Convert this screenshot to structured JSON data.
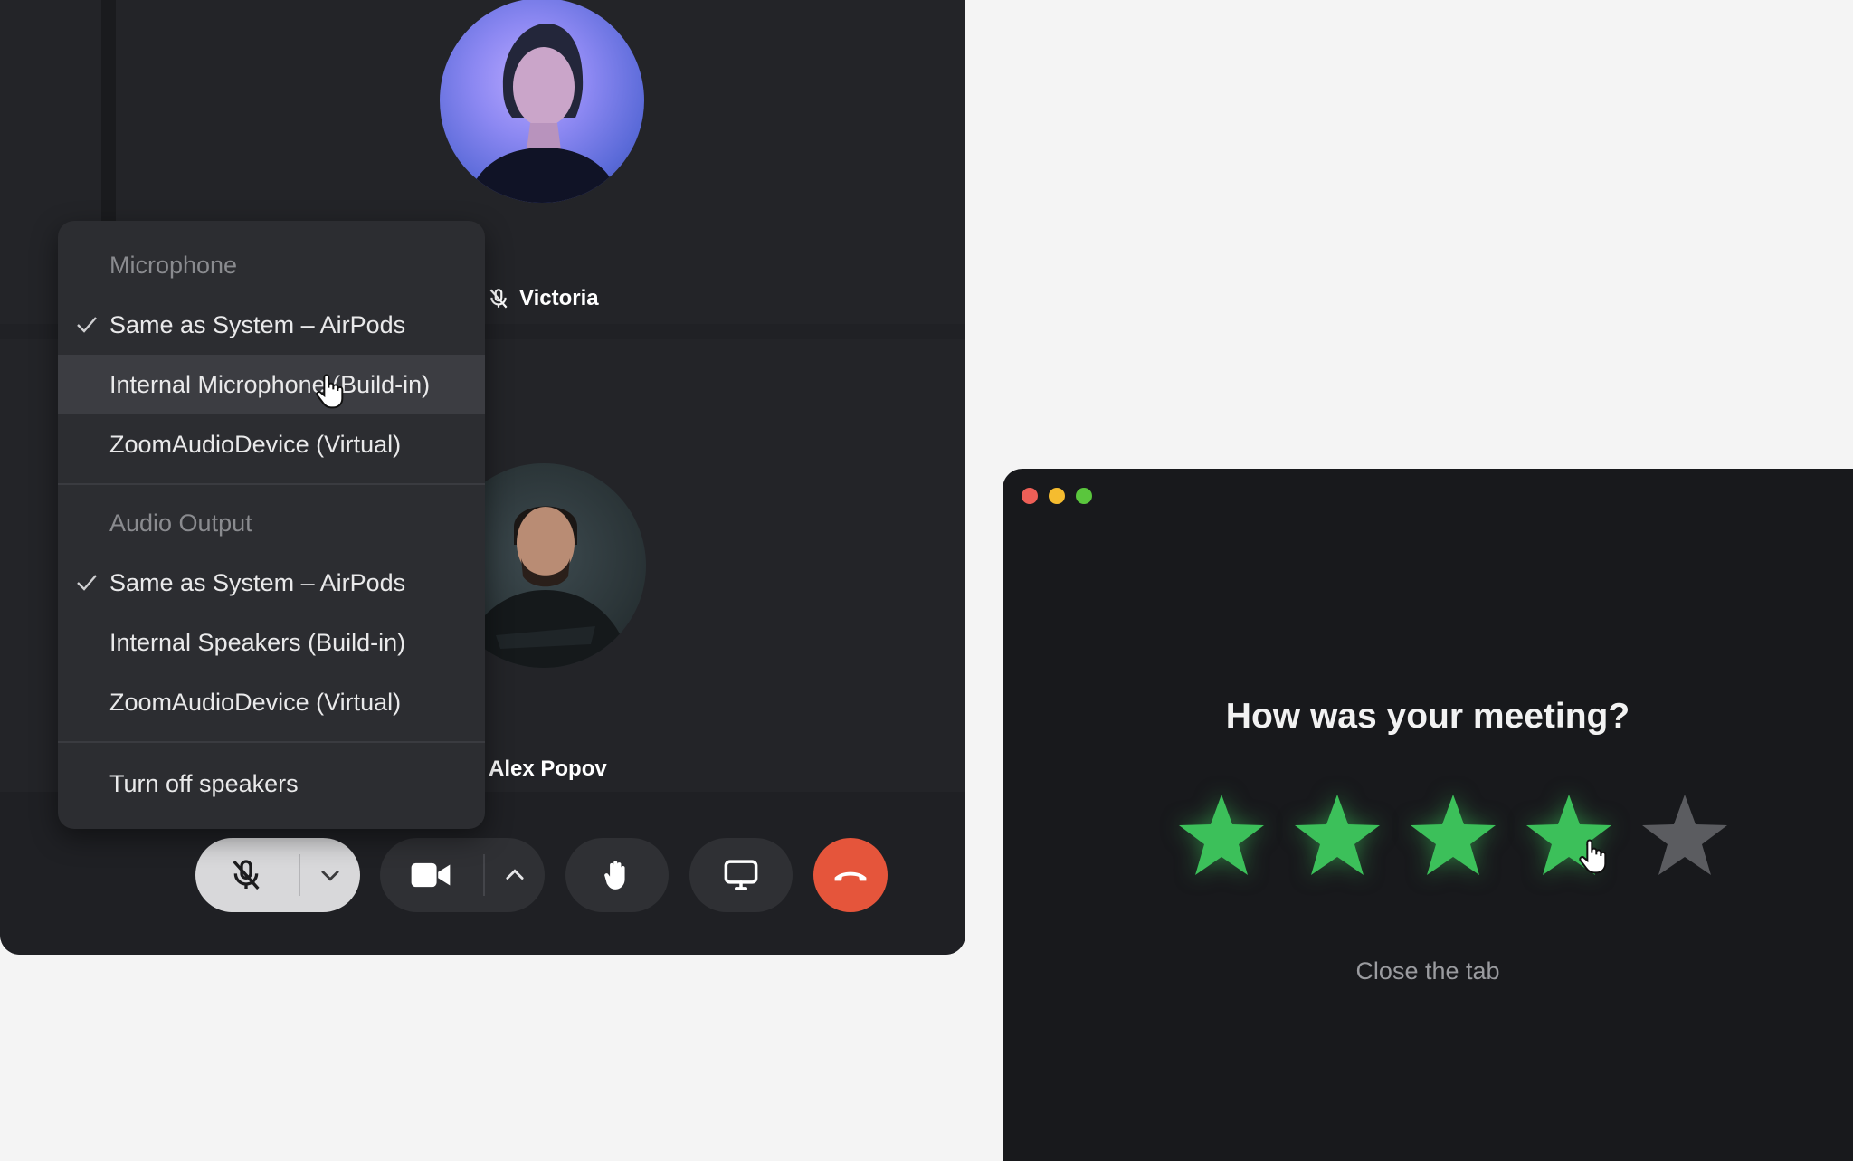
{
  "call": {
    "participants": [
      {
        "name": "Victoria",
        "muted": true,
        "avatar": "victoria-avatar"
      },
      {
        "name": "Alex Popov",
        "muted": false,
        "avatar": "alex-avatar"
      }
    ]
  },
  "audio_menu": {
    "microphone_title": "Microphone",
    "microphone_items": [
      {
        "label": "Same as System – AirPods",
        "checked": true
      },
      {
        "label": "Internal Microphone (Build-in)",
        "checked": false,
        "hovered": true
      },
      {
        "label": "ZoomAudioDevice (Virtual)",
        "checked": false
      }
    ],
    "output_title": "Audio Output",
    "output_items": [
      {
        "label": "Same as System – AirPods",
        "checked": true
      },
      {
        "label": "Internal Speakers (Build-in)",
        "checked": false
      },
      {
        "label": "ZoomAudioDevice (Virtual)",
        "checked": false
      }
    ],
    "turn_off_label": "Turn off speakers"
  },
  "toolbar": {
    "icons": [
      "mic-off-icon",
      "chevron-down-icon",
      "video-camera-icon",
      "chevron-up-icon",
      "raise-hand-icon",
      "screen-share-icon",
      "hang-up-icon"
    ],
    "colors": {
      "mic_button": "#d8d8da",
      "end_call": "#e5553b",
      "button": "#2f3034"
    }
  },
  "rating": {
    "title": "How was your meeting?",
    "rating_value": 4,
    "rating_max": 5,
    "close_label": "Close the tab",
    "colors": {
      "star_active": "#3cc05a",
      "star_inactive": "#5b5c60"
    }
  }
}
